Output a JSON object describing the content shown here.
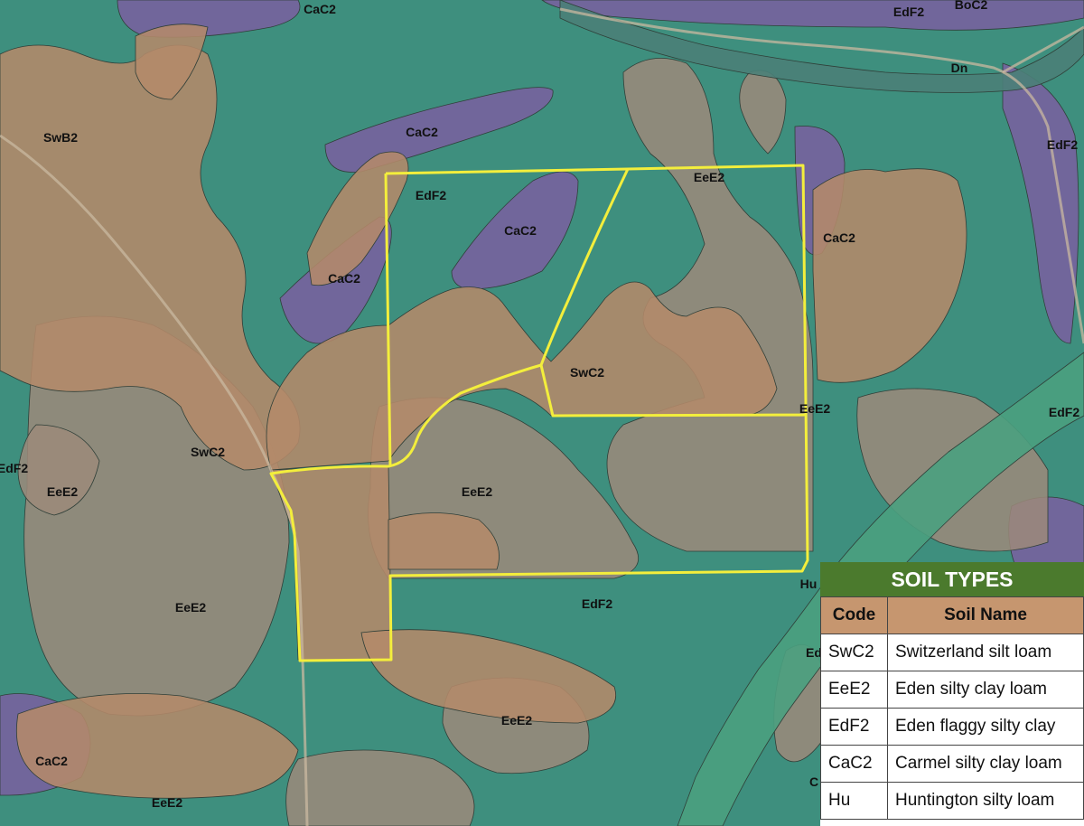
{
  "colors": {
    "forest": "#3e8f7e",
    "eden_silty_clay_loam": "#9c8a7a",
    "switzerland_silt_loam": "#b48a6a",
    "carmel": "#7a5fa0",
    "huntington": "#4aa080",
    "boundary": "#f3ee3c",
    "legend_header": "#4b7a2d",
    "legend_col_header": "#c6966f"
  },
  "map_labels": [
    {
      "id": "cac2-top",
      "text": "CaC2"
    },
    {
      "id": "edf2-top",
      "text": "EdF2"
    },
    {
      "id": "boc2-top",
      "text": "BoC2"
    },
    {
      "id": "dn",
      "text": "Dn"
    },
    {
      "id": "swb2",
      "text": "SwB2"
    },
    {
      "id": "cac2-upper",
      "text": "CaC2"
    },
    {
      "id": "edf2-right",
      "text": "EdF2"
    },
    {
      "id": "edf2-parcel",
      "text": "EdF2"
    },
    {
      "id": "eee2-parcel",
      "text": "EeE2"
    },
    {
      "id": "cac2-parcel",
      "text": "CaC2"
    },
    {
      "id": "cac2-right",
      "text": "CaC2"
    },
    {
      "id": "cac2-left",
      "text": "CaC2"
    },
    {
      "id": "swc2-center",
      "text": "SwC2"
    },
    {
      "id": "eee2-right",
      "text": "EeE2"
    },
    {
      "id": "edf2-far-right",
      "text": "EdF2"
    },
    {
      "id": "edf2-left",
      "text": "EdF2"
    },
    {
      "id": "eee2-left",
      "text": "EeE2"
    },
    {
      "id": "swc2-left",
      "text": "SwC2"
    },
    {
      "id": "eee2-mid",
      "text": "EeE2"
    },
    {
      "id": "hu",
      "text": "Hu"
    },
    {
      "id": "edf2-bottom",
      "text": "EdF2"
    },
    {
      "id": "eee2-lowleft",
      "text": "EeE2"
    },
    {
      "id": "eee2-bottom",
      "text": "EeE2"
    },
    {
      "id": "ed-partial",
      "text": "Ed"
    },
    {
      "id": "cac2-bottomleft",
      "text": "CaC2"
    },
    {
      "id": "eee2-bottomleft",
      "text": "EeE2"
    },
    {
      "id": "c-partial",
      "text": "C"
    }
  ],
  "legend": {
    "title": "SOIL TYPES",
    "headers": [
      "Code",
      "Soil Name"
    ],
    "rows": [
      [
        "SwC2",
        "Switzerland silt loam"
      ],
      [
        "EeE2",
        "Eden silty clay loam"
      ],
      [
        "EdF2",
        "Eden flaggy silty clay"
      ],
      [
        "CaC2",
        "Carmel silty clay loam"
      ],
      [
        "Hu",
        "Huntington silty loam"
      ]
    ]
  }
}
